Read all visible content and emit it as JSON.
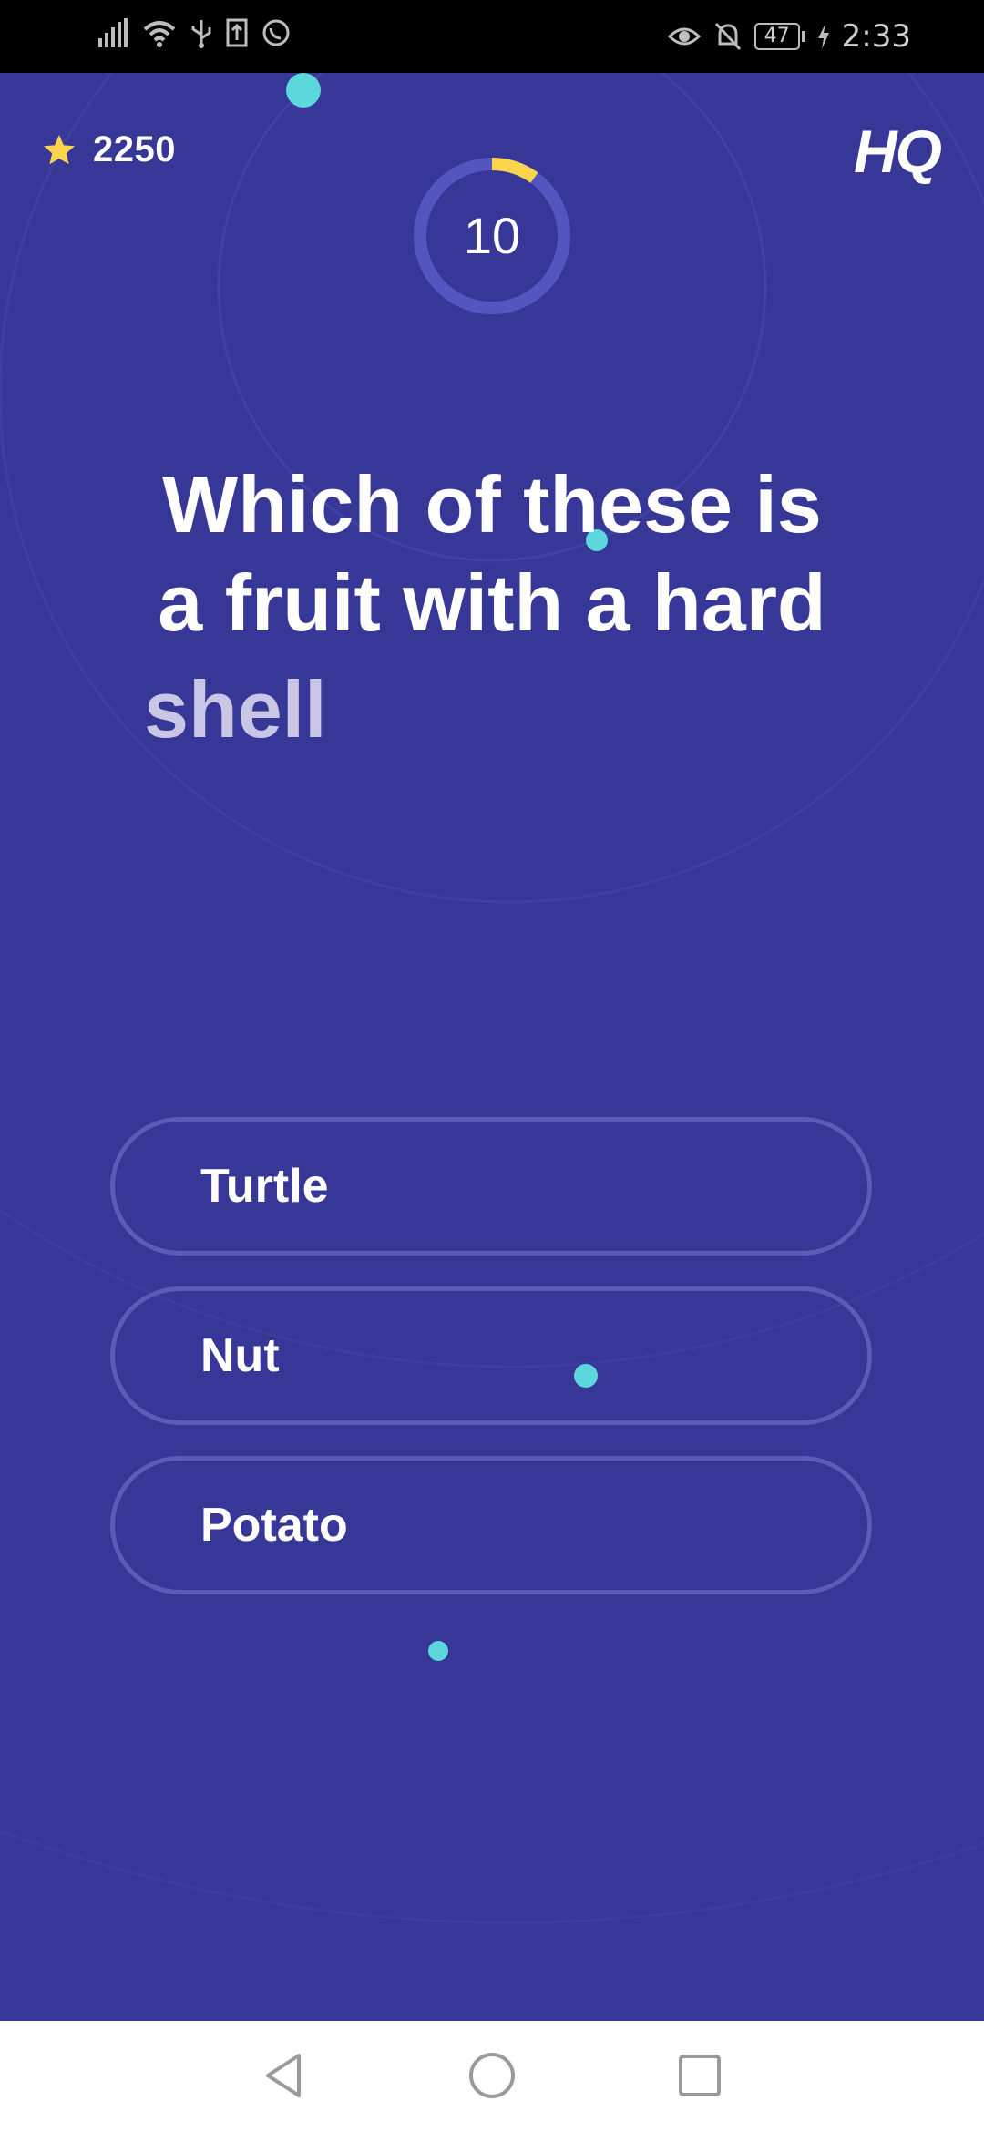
{
  "status_bar": {
    "time": "2:33",
    "battery": "47",
    "left_icons": [
      "signal-icon",
      "wifi-icon",
      "usb-icon",
      "upload-icon",
      "whatsapp-icon"
    ],
    "right_icons": [
      "eye-icon",
      "mute-bell-icon",
      "battery-icon",
      "charging-icon"
    ]
  },
  "header": {
    "score": "2250",
    "logo": "HQ",
    "timer_seconds": "10",
    "timer_progress": 0.1
  },
  "question": {
    "text": "Which of these is a fruit with a hard",
    "tail": "shell"
  },
  "answers": [
    {
      "label": "Turtle"
    },
    {
      "label": "Nut"
    },
    {
      "label": "Potato"
    }
  ],
  "colors": {
    "background": "#363797",
    "accent_yellow": "#f9d54c",
    "dot_teal": "#5cd7db",
    "answer_border": "#5a5cb6"
  },
  "nav_bar": {
    "icons": [
      "back-triangle-icon",
      "home-circle-icon",
      "recents-square-icon"
    ]
  }
}
